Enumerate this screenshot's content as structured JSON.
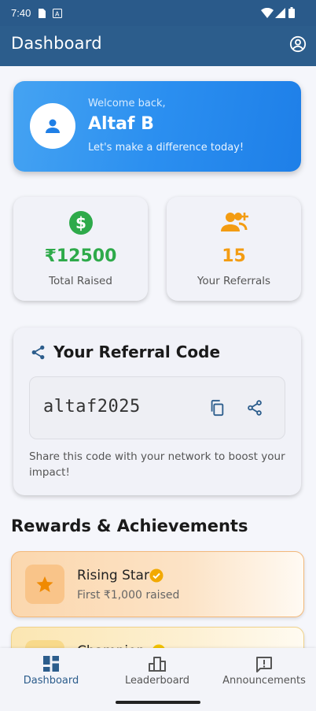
{
  "status_bar": {
    "time": "7:40"
  },
  "app_bar": {
    "title": "Dashboard"
  },
  "welcome": {
    "greeting": "Welcome back,",
    "name": "Altaf B",
    "tagline": "Let's make a difference today!"
  },
  "stats": [
    {
      "value": "₹12500",
      "label": "Total Raised",
      "color": "#2eaa4a"
    },
    {
      "value": "15",
      "label": "Your Referrals",
      "color": "#f39c12"
    }
  ],
  "referral": {
    "heading": "Your Referral Code",
    "code": "altaf2025",
    "hint": "Share this code with your network to boost your impact!"
  },
  "rewards": {
    "heading": "Rewards & Achievements",
    "items": [
      {
        "title": "Rising Star",
        "subtitle": "First ₹1,000 raised"
      },
      {
        "title": "Champion",
        "subtitle": ""
      }
    ]
  },
  "nav": {
    "items": [
      {
        "label": "Dashboard",
        "icon": "dashboard-icon",
        "active": true
      },
      {
        "label": "Leaderboard",
        "icon": "leaderboard-icon",
        "active": false
      },
      {
        "label": "Announcements",
        "icon": "announcements-icon",
        "active": false
      }
    ]
  },
  "colors": {
    "primary": "#2c5d8c",
    "accent_blue": "#2b8ff0",
    "money_green": "#2eaa4a",
    "orange": "#f39c12"
  }
}
